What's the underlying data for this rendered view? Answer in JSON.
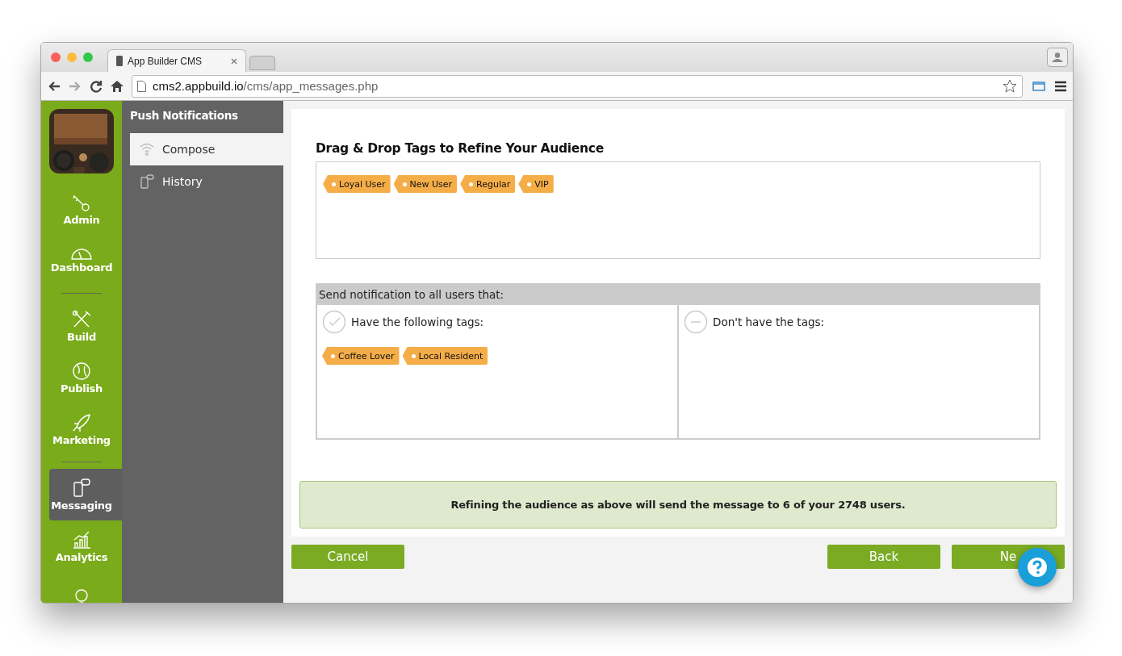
{
  "browser": {
    "tab_title": "App Builder CMS",
    "url_host": "cms2.appbuild.io",
    "url_path": "/cms/app_messages.php"
  },
  "nav": {
    "items": [
      {
        "kind": "item",
        "label": "Admin",
        "selected": false
      },
      {
        "kind": "item",
        "label": "Dashboard",
        "selected": false
      },
      {
        "kind": "divider"
      },
      {
        "kind": "item",
        "label": "Build",
        "selected": false
      },
      {
        "kind": "item",
        "label": "Publish",
        "selected": false
      },
      {
        "kind": "item",
        "label": "Marketing",
        "selected": false
      },
      {
        "kind": "divider"
      },
      {
        "kind": "item",
        "label": "Messaging",
        "selected": true
      },
      {
        "kind": "item",
        "label": "Analytics",
        "selected": false
      },
      {
        "kind": "item",
        "selected": false
      }
    ]
  },
  "submenu": {
    "title": "Push Notifications",
    "items": [
      {
        "label": "Compose",
        "selected": true
      },
      {
        "label": "History",
        "selected": false
      }
    ]
  },
  "audience": {
    "heading": "Drag & Drop Tags to Refine Your Audience",
    "available_tags": [
      "Loyal User",
      "New User",
      "Regular",
      "VIP"
    ],
    "filter": {
      "title": "Send notification to all users that:",
      "include": {
        "label": "Have the following tags:",
        "tags": [
          "Coffee Lover",
          "Local Resident"
        ]
      },
      "exclude": {
        "label": "Don't have the tags:"
      }
    }
  },
  "summary": "Refining the audience as above will send the message to 6 of your 2748 users.",
  "buttons": {
    "cancel": "Cancel",
    "back": "Back",
    "next": "Ne"
  }
}
